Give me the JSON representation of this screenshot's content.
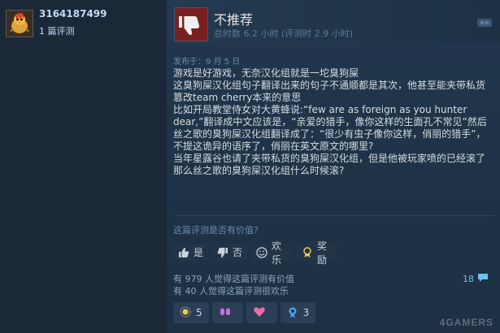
{
  "author": {
    "name": "3164187499",
    "review_count": "1 篇评测"
  },
  "review": {
    "recommendation": "不推荐",
    "hours": "总时数 6.2 小时  (评测时 2.9 小时)",
    "posted": "发布于：9 月 5 日",
    "paragraphs": [
      "游戏是好游戏，无奈汉化组就是一坨臭狗屎",
      "这臭狗屎汉化组句子翻译出来的句子不通顺都是其次，他甚至能夹带私货篡改team cherry本来的意思",
      "比如开局教堂侍女对大黄蜂说:“few are as foreign as you hunter dear,”翻译成中文应该是，“亲爱的猎手，像你这样的生面孔不常见”然后丝之歌的臭狗屎汉化组翻译成了：“很少有虫子像你这样，俏丽的猎手”，不提这诡异的语序了，俏丽在英文原文的哪里?",
      "当年星露谷也请了夹带私货的臭狗屎汉化组，但是他被玩家喷的已经滚了",
      "那么丝之歌的臭狗屎汉化组什么时候滚?"
    ]
  },
  "rating": {
    "question": "这篇评测是否有价值?",
    "buttons": {
      "yes": "是",
      "no": "否",
      "funny": "欢乐",
      "award": "奖励"
    }
  },
  "stats": {
    "helpful": "有 979 人觉得这篇评测有价值",
    "funny": "有 40 人觉得这篇评测很欢乐",
    "comments": "18"
  },
  "awards": [
    {
      "icon": "sun-award-icon",
      "count": "5",
      "color": "#f2c94c"
    },
    {
      "icon": "hands-award-icon",
      "count": "",
      "color": "#c86ee0"
    },
    {
      "icon": "heart-award-icon",
      "count": "",
      "color": "#e86fa8"
    },
    {
      "icon": "medal-award-icon",
      "count": "3",
      "color": "#4aa3f0"
    }
  ],
  "watermark": "4GAMERS",
  "colors": {
    "thumb_down_bg": "#7a1f1f",
    "link": "#67c1f5"
  }
}
